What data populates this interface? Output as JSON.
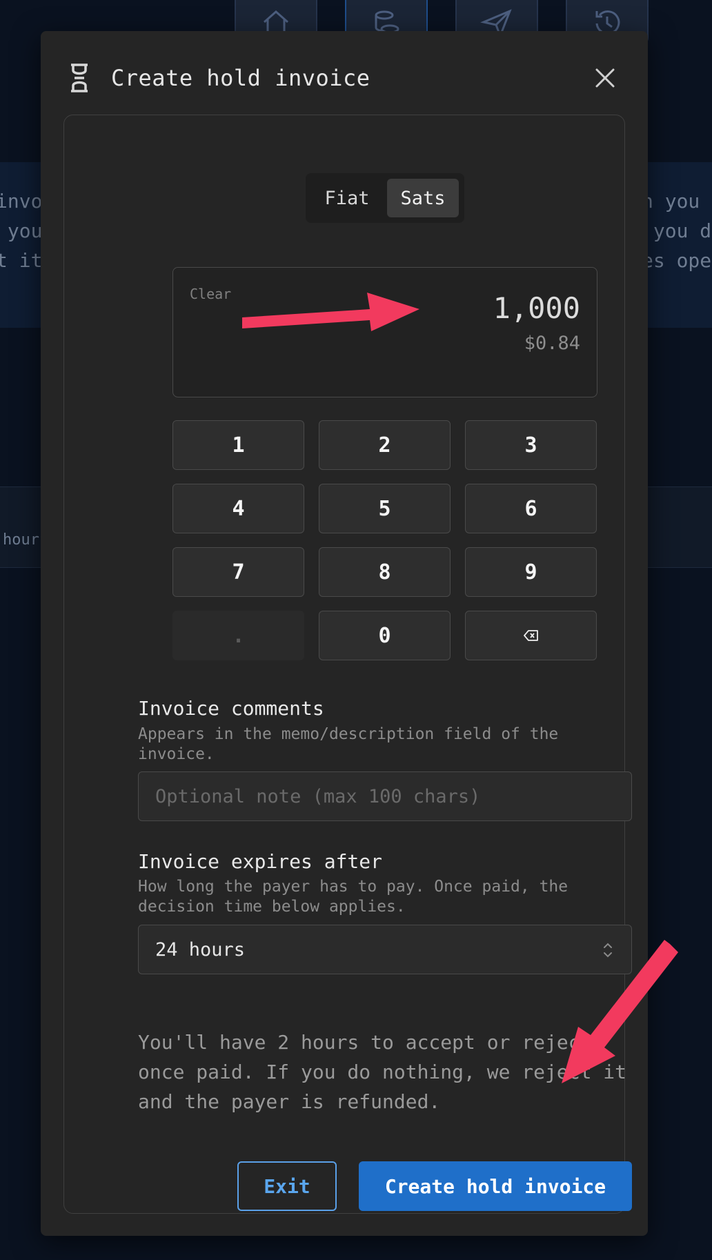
{
  "background": {
    "nav_icons": [
      "home-icon",
      "coins-icon",
      "send-icon",
      "history-icon"
    ],
    "text_left": [
      "invo",
      " you",
      "t it"
    ],
    "text_right": [
      "n you",
      " you d",
      "es ope"
    ],
    "hour_text": "hour"
  },
  "modal": {
    "title": "Create hold invoice",
    "icon": "hourglass-icon",
    "close_icon": "close-icon"
  },
  "unit_toggle": {
    "options": [
      "Fiat",
      "Sats"
    ],
    "selected": "Sats"
  },
  "amount_display": {
    "clear_label": "Clear",
    "amount": "1,000",
    "fiat_value": "$0.84"
  },
  "keypad": {
    "keys": [
      "1",
      "2",
      "3",
      "4",
      "5",
      "6",
      "7",
      "8",
      "9",
      ".",
      "0",
      "backspace"
    ],
    "disabled": [
      "."
    ]
  },
  "comments": {
    "label": "Invoice comments",
    "help": "Appears in the memo/description field of the invoice.",
    "placeholder": "Optional note (max 100 chars)",
    "value": ""
  },
  "expiry": {
    "label": "Invoice expires after",
    "help": "How long the payer has to pay. Once paid, the decision time below applies.",
    "selected": "24 hours"
  },
  "note": "You'll have 2 hours to accept or reject once paid. If you do nothing, we reject it and the payer is refunded.",
  "actions": {
    "exit_label": "Exit",
    "create_label": "Create hold invoice"
  },
  "colors": {
    "accent": "#1f6fc9",
    "annotation_arrow": "#f23a5e",
    "modal_bg": "#252525"
  }
}
